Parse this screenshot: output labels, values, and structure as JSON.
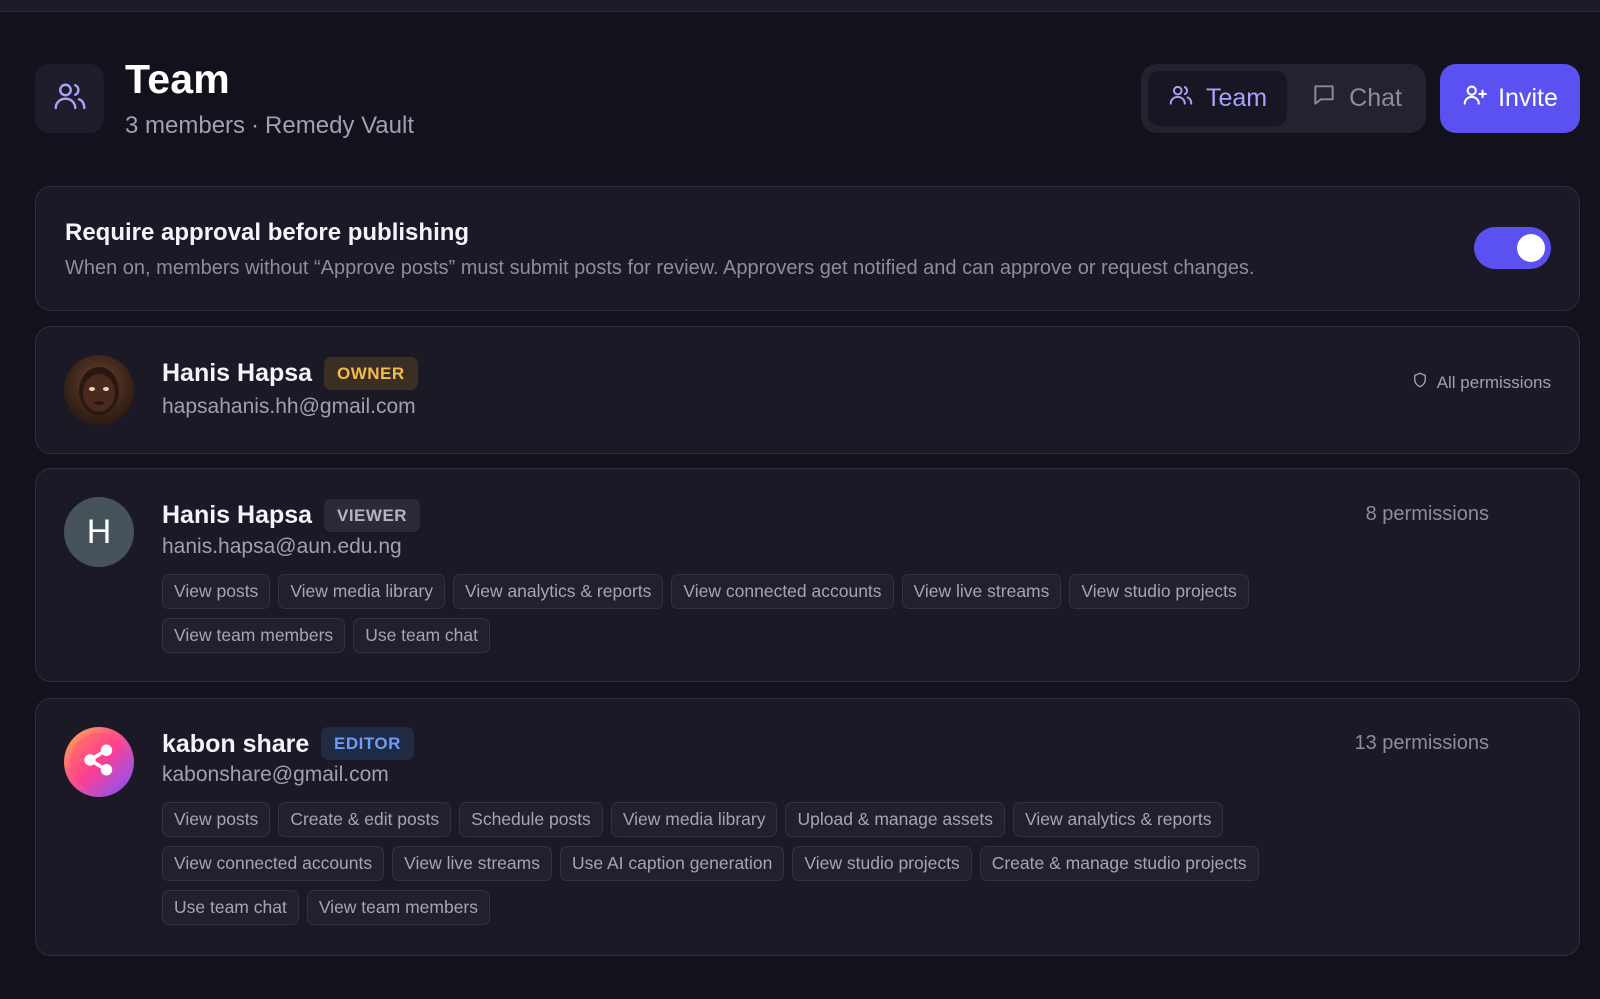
{
  "header": {
    "icon": "users-icon",
    "title": "Team",
    "member_count": "3 members",
    "separator": "·",
    "workspace": "Remedy Vault"
  },
  "tabs": [
    {
      "label": "Team",
      "icon": "users-icon",
      "active": true
    },
    {
      "label": "Chat",
      "icon": "chat-bubble-icon",
      "active": false
    }
  ],
  "invite_button": {
    "label": "Invite",
    "icon": "user-plus-icon"
  },
  "approval": {
    "title": "Require approval before publishing",
    "description": "When on, members without “Approve posts” must submit posts for review. Approvers get notified and can approve or request changes.",
    "enabled": true
  },
  "members": [
    {
      "name": "Hanis Hapsa",
      "role": "OWNER",
      "email": "hapsahanis.hh@gmail.com",
      "avatar": "photo",
      "permissions_summary": "All permissions",
      "permissions": []
    },
    {
      "name": "Hanis Hapsa",
      "role": "VIEWER",
      "email": "hanis.hapsa@aun.edu.ng",
      "avatar_letter": "H",
      "permissions_summary": "8 permissions",
      "permissions": [
        "View posts",
        "View media library",
        "View analytics & reports",
        "View connected accounts",
        "View live streams",
        "View studio projects",
        "View team members",
        "Use team chat"
      ]
    },
    {
      "name": "kabon share",
      "role": "EDITOR",
      "email": "kabonshare@gmail.com",
      "avatar": "share-logo",
      "permissions_summary": "13 permissions",
      "permissions": [
        "View posts",
        "Create & edit posts",
        "Schedule posts",
        "View media library",
        "Upload & manage assets",
        "View analytics & reports",
        "View connected accounts",
        "View live streams",
        "Use AI caption generation",
        "View studio projects",
        "Create & manage studio projects",
        "Use team chat",
        "View team members"
      ]
    }
  ],
  "colors": {
    "background": "#13111c",
    "card": "#1b1926",
    "accent": "#5b50f0",
    "owner_badge": "#f5b94e",
    "editor_badge": "#6f9cf4"
  }
}
